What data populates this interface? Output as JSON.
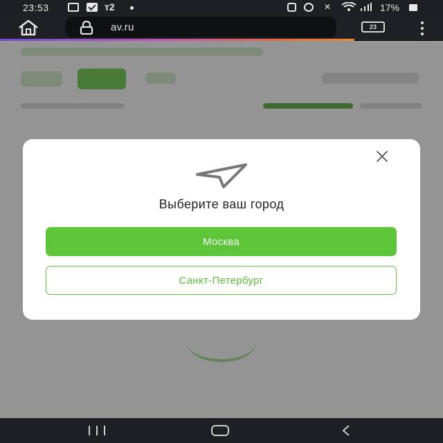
{
  "status_bar": {
    "time": "23:53",
    "carrier": "т2",
    "battery_percent": "17%",
    "icons": [
      "photo-icon",
      "mail-icon",
      "dot-icon",
      "screenshot-icon",
      "alarm-icon",
      "mute-icon",
      "wifi-icon",
      "signal-icon",
      "battery-icon"
    ]
  },
  "browser": {
    "url": "av.ru",
    "tabs_count": "23",
    "progress_fraction": 0.8
  },
  "modal": {
    "title": "Выберите ваш город",
    "primary_button": "Москва",
    "secondary_button": "Санкт-Петербург",
    "icon": "navigation-arrow-icon"
  },
  "colors": {
    "accent": "#5ec43a",
    "overlay": "rgba(0,0,0,0.42)",
    "system_bar": "#1d1f22"
  }
}
